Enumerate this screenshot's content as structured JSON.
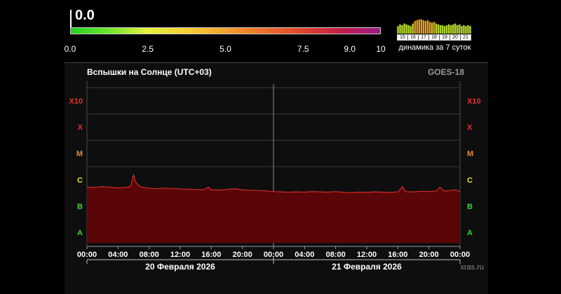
{
  "indicator": {
    "current_value": "0.0",
    "scale_ticks": [
      {
        "label": "0.0",
        "value": 0
      },
      {
        "label": "2.5",
        "value": 2.5
      },
      {
        "label": "5.0",
        "value": 5
      },
      {
        "label": "7.5",
        "value": 7.5
      },
      {
        "label": "9.0",
        "value": 9
      },
      {
        "label": "10",
        "value": 10
      }
    ],
    "colors": {
      "low": "#1fd11f",
      "mid": "#e9f23a",
      "high": "#e0432b",
      "max": "#9b1a8a"
    }
  },
  "weekly": {
    "caption": "динамика за 7 суток",
    "days": [
      "15",
      "16",
      "17",
      "18",
      "19",
      "20",
      "21"
    ],
    "bar_levels": [
      0.45,
      0.55,
      0.5,
      0.6,
      0.55,
      0.5,
      0.45,
      0.6,
      0.75,
      0.8,
      0.85,
      0.85,
      0.8,
      0.75,
      0.8,
      0.7,
      0.65,
      0.7,
      0.6,
      0.55,
      0.5,
      0.5,
      0.45,
      0.5,
      0.55,
      0.5,
      0.55,
      0.6,
      0.5,
      0.55,
      0.45,
      0.5,
      0.45,
      0.5,
      0.45
    ],
    "bar_color_strong": "#e59a1f",
    "bar_color_weak": "#b4d82b"
  },
  "chart_data": {
    "type": "area",
    "title": "Вспышки на Солнце (UTC+03)",
    "source_label": "GOES-18",
    "watermark": "xras.ru",
    "y_scale": "log",
    "y_classes": [
      {
        "label": "A",
        "color": "#37d337"
      },
      {
        "label": "B",
        "color": "#37d337"
      },
      {
        "label": "C",
        "color": "#e6e63a"
      },
      {
        "label": "M",
        "color": "#f08a2a"
      },
      {
        "label": "X",
        "color": "#e63030"
      },
      {
        "label": "X10",
        "color": "#e63030"
      }
    ],
    "x_tick_labels": [
      "00:00",
      "04:00",
      "08:00",
      "12:00",
      "16:00",
      "20:00",
      "00:00",
      "04:00",
      "08:00",
      "12:00",
      "16:00",
      "20:00",
      "00:00"
    ],
    "dates": [
      "20 Февраля 2026",
      "21 Февраля 2026"
    ],
    "grid": true,
    "fill_color": "#5a0608",
    "line_color": "#d42a2a",
    "series": [
      {
        "x_hours": [
          0,
          1,
          2,
          3,
          4,
          5,
          5.6,
          6,
          6.2,
          6.6,
          7,
          8,
          9,
          10,
          11,
          12,
          13,
          14,
          15,
          15.6,
          16,
          17,
          18,
          19,
          20,
          21,
          22,
          23,
          24,
          25,
          26,
          27,
          28,
          29,
          30,
          31,
          32,
          33,
          34,
          35,
          36,
          37,
          38,
          39,
          40,
          40.6,
          41,
          42,
          43,
          44,
          45,
          45.4,
          46,
          47,
          47.4,
          48
        ],
        "class_level": [
          1.72,
          1.71,
          1.74,
          1.72,
          1.69,
          1.71,
          1.74,
          2.2,
          1.95,
          1.8,
          1.72,
          1.68,
          1.66,
          1.68,
          1.67,
          1.65,
          1.64,
          1.63,
          1.62,
          1.72,
          1.62,
          1.61,
          1.63,
          1.66,
          1.62,
          1.6,
          1.59,
          1.58,
          1.55,
          1.54,
          1.53,
          1.54,
          1.53,
          1.55,
          1.54,
          1.53,
          1.55,
          1.52,
          1.51,
          1.53,
          1.52,
          1.54,
          1.53,
          1.52,
          1.54,
          1.73,
          1.55,
          1.54,
          1.56,
          1.55,
          1.58,
          1.72,
          1.57,
          1.6,
          1.62,
          1.55
        ]
      }
    ]
  }
}
